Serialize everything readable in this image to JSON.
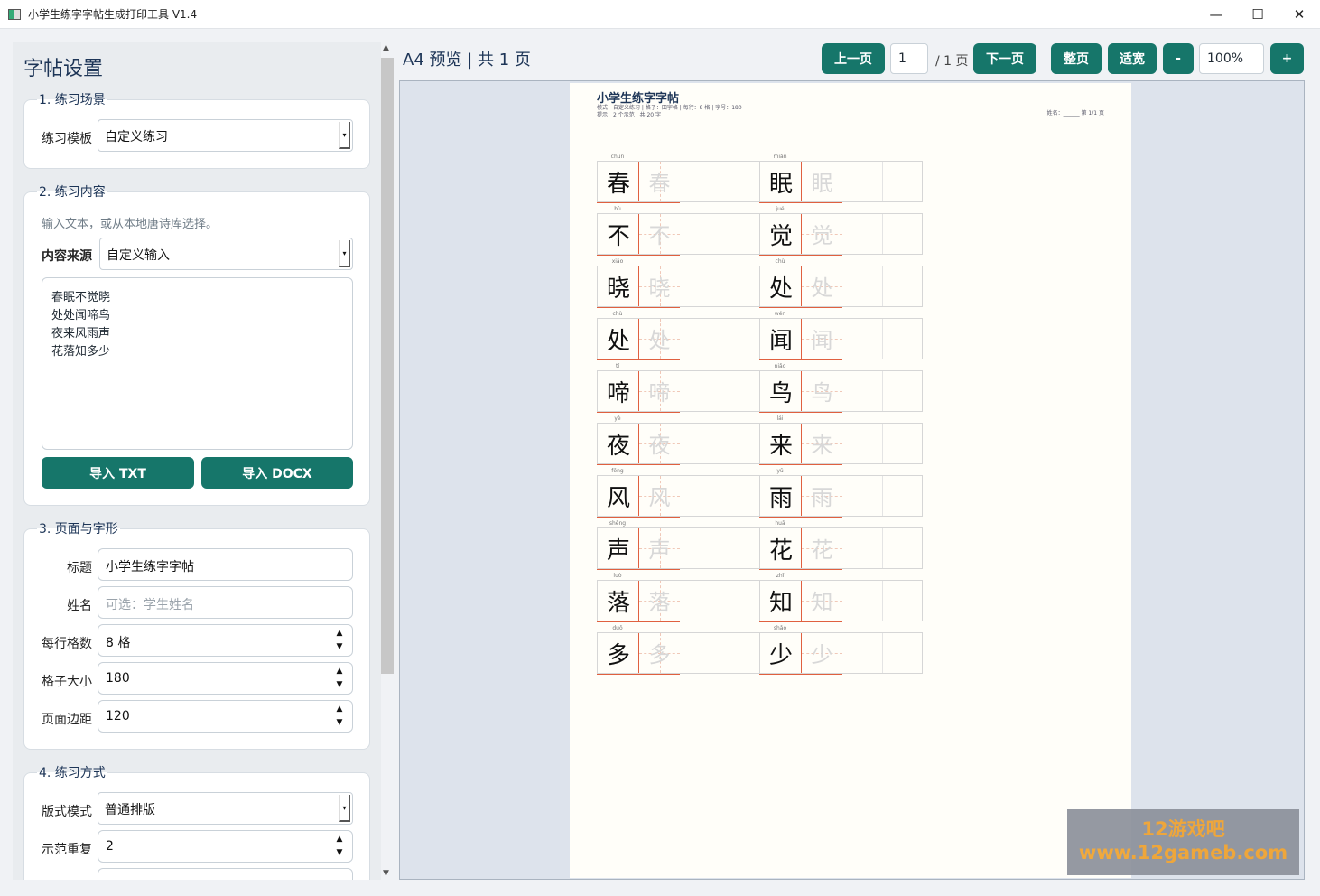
{
  "window": {
    "title": "小学生练字字帖生成打印工具 V1.4",
    "controls": {
      "minimize": "—",
      "maximize": "☐",
      "close": "✕"
    }
  },
  "sidebar": {
    "title": "字帖设置",
    "scenario": {
      "label": "1. 练习场景",
      "template_label": "练习模板",
      "template_value": "自定义练习"
    },
    "content": {
      "label": "2. 练习内容",
      "hint": "输入文本，或从本地唐诗库选择。",
      "source_label": "内容来源",
      "source_value": "自定义输入",
      "text": "春眠不觉晓\n处处闻啼鸟\n夜来风雨声\n花落知多少",
      "import_txt": "导入 TXT",
      "import_docx": "导入 DOCX"
    },
    "page": {
      "label": "3. 页面与字形",
      "title_label": "标题",
      "title_value": "小学生练字字帖",
      "name_label": "姓名",
      "name_placeholder": "可选：学生姓名",
      "per_row_label": "每行格数",
      "per_row_value": "8 格",
      "cell_size_label": "格子大小",
      "cell_size_value": "180",
      "margin_label": "页面边距",
      "margin_value": "120"
    },
    "practice": {
      "label": "4. 练习方式",
      "layout_label": "版式模式",
      "layout_value": "普通排版",
      "repeat_label": "示范重复",
      "repeat_value": "2"
    }
  },
  "toolbar": {
    "heading": "A4 预览  |  共 1 页",
    "prev": "上一页",
    "page_value": "1",
    "page_total": "/ 1 页",
    "next": "下一页",
    "fit_page": "整页",
    "fit_width": "适宽",
    "zoom_out": "-",
    "zoom_value": "100%",
    "zoom_in": "+"
  },
  "paper": {
    "title": "小学生练字字帖",
    "info_line1": "模式：自定义练习 | 格子：田字格 | 每行：8 格 | 字号：180",
    "info_line2": "提示：2 个示范 | 共 20 字",
    "meta": "姓名：______    第 1/1 页",
    "left_column": [
      {
        "char": "春",
        "pinyin": "chūn"
      },
      {
        "char": "不",
        "pinyin": "bù"
      },
      {
        "char": "晓",
        "pinyin": "xiǎo"
      },
      {
        "char": "处",
        "pinyin": "chù"
      },
      {
        "char": "啼",
        "pinyin": "tí"
      },
      {
        "char": "夜",
        "pinyin": "yè"
      },
      {
        "char": "风",
        "pinyin": "fēng"
      },
      {
        "char": "声",
        "pinyin": "shēng"
      },
      {
        "char": "落",
        "pinyin": "luò"
      },
      {
        "char": "多",
        "pinyin": "duō"
      }
    ],
    "right_column": [
      {
        "char": "眠",
        "pinyin": "mián"
      },
      {
        "char": "觉",
        "pinyin": "jué"
      },
      {
        "char": "处",
        "pinyin": "chù"
      },
      {
        "char": "闻",
        "pinyin": "wén"
      },
      {
        "char": "鸟",
        "pinyin": "niǎo"
      },
      {
        "char": "来",
        "pinyin": "lái"
      },
      {
        "char": "雨",
        "pinyin": "yǔ"
      },
      {
        "char": "花",
        "pinyin": "huā"
      },
      {
        "char": "知",
        "pinyin": "zhī"
      },
      {
        "char": "少",
        "pinyin": "shǎo"
      }
    ]
  },
  "watermark": {
    "line1": "12游戏吧",
    "line2": "www.12gameb.com"
  }
}
